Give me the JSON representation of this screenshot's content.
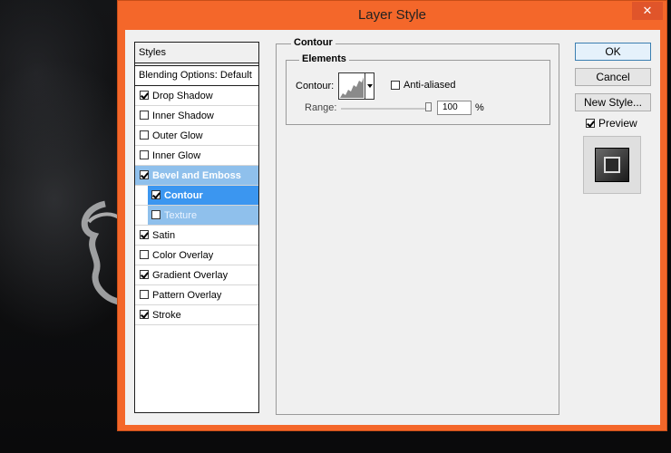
{
  "dialog": {
    "title": "Layer Style",
    "close_label": "✕"
  },
  "styles": {
    "header": "Styles",
    "blending_options": "Blending Options: Default",
    "items": [
      {
        "label": "Drop Shadow",
        "checked": true
      },
      {
        "label": "Inner Shadow",
        "checked": false
      },
      {
        "label": "Outer Glow",
        "checked": false
      },
      {
        "label": "Inner Glow",
        "checked": false
      },
      {
        "label": "Bevel and Emboss",
        "checked": true
      },
      {
        "label": "Contour",
        "checked": true
      },
      {
        "label": "Texture",
        "checked": false
      },
      {
        "label": "Satin",
        "checked": true
      },
      {
        "label": "Color Overlay",
        "checked": false
      },
      {
        "label": "Gradient Overlay",
        "checked": true
      },
      {
        "label": "Pattern Overlay",
        "checked": false
      },
      {
        "label": "Stroke",
        "checked": true
      }
    ]
  },
  "contour_panel": {
    "group_title": "Contour",
    "elements_title": "Elements",
    "contour_label": "Contour:",
    "anti_aliased_label": "Anti-aliased",
    "anti_aliased_checked": false,
    "range_label": "Range:",
    "range_value": "100",
    "range_unit": "%"
  },
  "buttons": {
    "ok": "OK",
    "cancel": "Cancel",
    "new_style": "New Style...",
    "preview_label": "Preview",
    "preview_checked": true
  },
  "colors": {
    "title_bar": "#f4672a",
    "selected_item": "#3b96f0",
    "selected_parent": "#8fc0ec"
  }
}
